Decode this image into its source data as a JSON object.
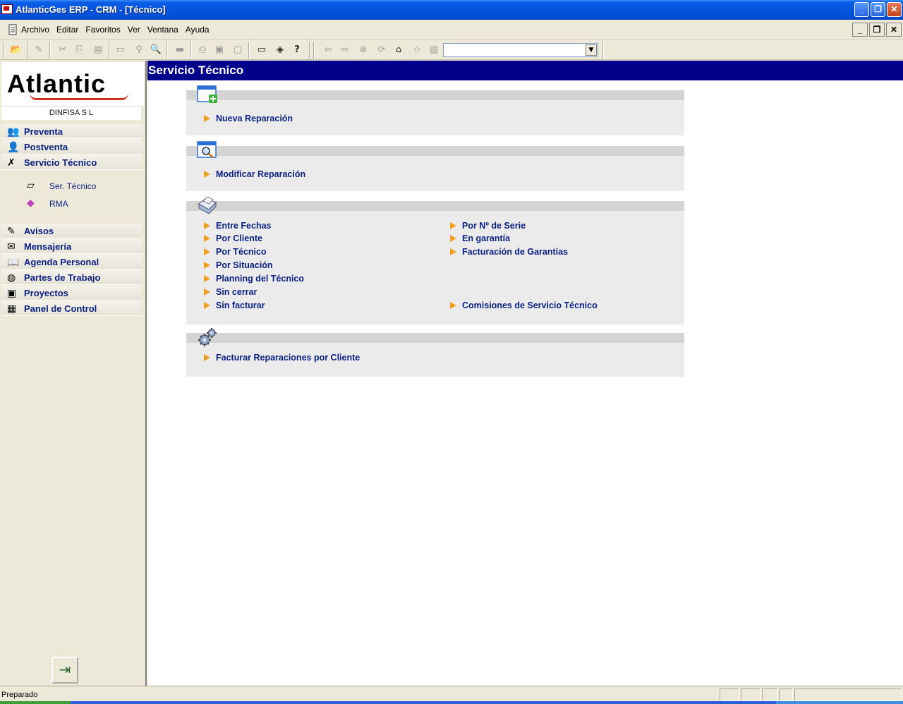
{
  "window": {
    "title": "AtlanticGes ERP - CRM - [Técnico]",
    "controls": {
      "minimize": "_",
      "maximize": "❐",
      "close": "✕"
    }
  },
  "menu": {
    "items": [
      "Archivo",
      "Editar",
      "Favoritos",
      "Ver",
      "Ventana",
      "Ayuda"
    ],
    "mdi_controls": {
      "minimize": "_",
      "restore": "❐",
      "close": "✕"
    }
  },
  "toolbar": {
    "combo_value": "",
    "combo_arrow": "▼"
  },
  "sidebar": {
    "logo_text": "Atlantic",
    "company": "DINFISA  S L",
    "items": [
      {
        "label": "Preventa",
        "icon": "users-icon"
      },
      {
        "label": "Postventa",
        "icon": "person-icon"
      },
      {
        "label": "Servicio Técnico",
        "icon": "tools-icon"
      },
      {
        "label": "Avisos",
        "icon": "note-icon"
      },
      {
        "label": "Mensajería",
        "icon": "envelope-icon"
      },
      {
        "label": "Agenda Personal",
        "icon": "book-icon"
      },
      {
        "label": "Partes de Trabajo",
        "icon": "globe-icon"
      },
      {
        "label": "Proyectos",
        "icon": "monitor-icon"
      },
      {
        "label": "Panel de Control",
        "icon": "calendar-icon"
      }
    ],
    "sub_items": [
      {
        "label": "Ser. Técnico",
        "icon": "box-icon"
      },
      {
        "label": "RMA",
        "icon": "rma-box-icon"
      }
    ],
    "exit_icon": "exit-door-icon"
  },
  "main": {
    "title": "Servicio Técnico",
    "sections": [
      {
        "icon": "new-window-icon",
        "links": [
          "Nueva Reparación"
        ]
      },
      {
        "icon": "search-window-icon",
        "links": [
          "Modificar Reparación"
        ]
      },
      {
        "icon": "printer-icon",
        "links_left": [
          "Entre Fechas",
          "Por Cliente",
          "Por Técnico",
          "Por Situación",
          "Planning del Técnico",
          "Sin cerrar",
          "Sin facturar"
        ],
        "links_right": [
          "Por Nº de Serie",
          "En garantía",
          "Facturación de Garantías",
          "Comisiones de Servicio Técnico"
        ]
      },
      {
        "icon": "gears-icon",
        "links": [
          "Facturar Reparaciones por Cliente"
        ]
      }
    ]
  },
  "status": {
    "text": "Preparado"
  },
  "colors": {
    "title_bar": "#0453dc",
    "page_header": "#00008b",
    "link_text": "#0a1f82",
    "link_arrow": "#f0a020",
    "section_bg": "#ebebeb",
    "section_band": "#d4d4d4"
  }
}
